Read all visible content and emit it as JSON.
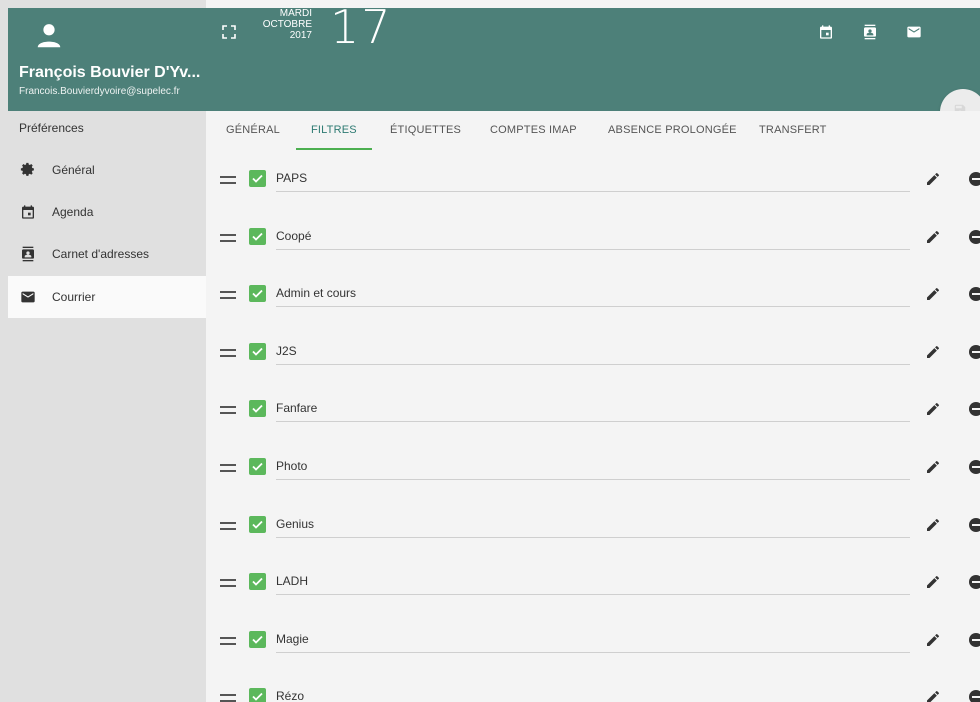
{
  "user": {
    "name": "François Bouvier D'Yv...",
    "email": "Francois.Bouvierdyvoire@supelec.fr"
  },
  "sidebar": {
    "title": "Préférences",
    "items": [
      {
        "label": "Général",
        "icon": "gear-icon"
      },
      {
        "label": "Agenda",
        "icon": "calendar-icon"
      },
      {
        "label": "Carnet d'adresses",
        "icon": "contacts-icon"
      },
      {
        "label": "Courrier",
        "icon": "mail-icon"
      }
    ]
  },
  "date": {
    "weekday": "MARDI",
    "month": "OCTOBRE",
    "year": "2017",
    "day": "17"
  },
  "tabs": [
    {
      "label": "GÉNÉRAL"
    },
    {
      "label": "FILTRES"
    },
    {
      "label": "ÉTIQUETTES"
    },
    {
      "label": "COMPTES IMAP"
    },
    {
      "label": "ABSENCE PROLONGÉE"
    },
    {
      "label": "TRANSFERT"
    }
  ],
  "active_tab": "FILTRES",
  "filters": [
    {
      "name": "PAPS",
      "enabled": true
    },
    {
      "name": "Coopé",
      "enabled": true
    },
    {
      "name": "Admin et cours",
      "enabled": true
    },
    {
      "name": "J2S",
      "enabled": true
    },
    {
      "name": "Fanfare",
      "enabled": true
    },
    {
      "name": "Photo",
      "enabled": true
    },
    {
      "name": "Genius",
      "enabled": true
    },
    {
      "name": "LADH",
      "enabled": true
    },
    {
      "name": "Magie",
      "enabled": true
    },
    {
      "name": "Rézo",
      "enabled": true
    }
  ],
  "colors": {
    "header": "#4d8079",
    "accent": "#4caf50",
    "checkbox": "#5cb85c"
  }
}
